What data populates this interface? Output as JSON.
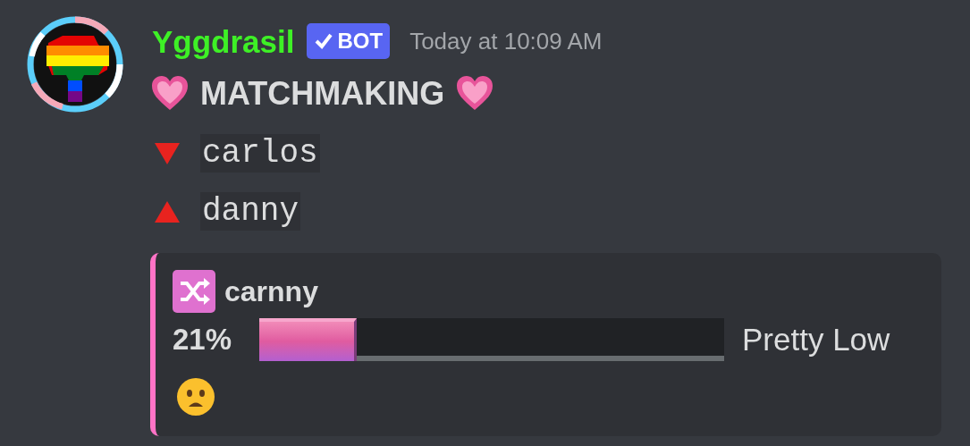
{
  "message": {
    "author": "Yggdrasil",
    "badge": "BOT",
    "timestamp": "Today at 10:09 AM",
    "heading": "MATCHMAKING",
    "people": [
      {
        "kind": "down",
        "name": "carlos"
      },
      {
        "kind": "up",
        "name": "danny"
      }
    ],
    "embed": {
      "title": "carnny",
      "percent": "21%",
      "level": 0.21,
      "verdict": "Pretty Low"
    }
  }
}
